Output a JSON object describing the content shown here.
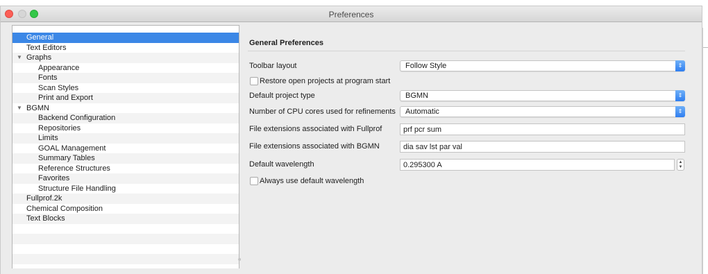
{
  "window": {
    "title": "Preferences"
  },
  "sidebar": {
    "items": [
      {
        "label": "General",
        "level": 0,
        "expandable": false,
        "selected": true
      },
      {
        "label": "Text Editors",
        "level": 0,
        "expandable": false
      },
      {
        "label": "Graphs",
        "level": 0,
        "expandable": true,
        "expanded": true
      },
      {
        "label": "Appearance",
        "level": 1
      },
      {
        "label": "Fonts",
        "level": 1
      },
      {
        "label": "Scan Styles",
        "level": 1
      },
      {
        "label": "Print and Export",
        "level": 1
      },
      {
        "label": "BGMN",
        "level": 0,
        "expandable": true,
        "expanded": true
      },
      {
        "label": "Backend Configuration",
        "level": 1
      },
      {
        "label": "Repositories",
        "level": 1
      },
      {
        "label": "Limits",
        "level": 1
      },
      {
        "label": "GOAL Management",
        "level": 1
      },
      {
        "label": "Summary Tables",
        "level": 1
      },
      {
        "label": "Reference Structures",
        "level": 1
      },
      {
        "label": "Favorites",
        "level": 1
      },
      {
        "label": "Structure File Handling",
        "level": 1
      },
      {
        "label": "Fullprof.2k",
        "level": 0
      },
      {
        "label": "Chemical Composition",
        "level": 0
      },
      {
        "label": "Text Blocks",
        "level": 0
      }
    ],
    "expand_arrow": "▼"
  },
  "main": {
    "title": "General Preferences",
    "toolbar_layout": {
      "label": "Toolbar layout",
      "value": "Follow Style"
    },
    "restore_projects": {
      "label": "Restore open projects at program start",
      "checked": false
    },
    "default_project_type": {
      "label": "Default project type",
      "value": "BGMN"
    },
    "cpu_cores": {
      "label": "Number of CPU cores used for refinements",
      "value": "Automatic"
    },
    "fullprof_ext": {
      "label": "File extensions associated with Fullprof",
      "value": "prf pcr sum"
    },
    "bgmn_ext": {
      "label": "File extensions associated with BGMN",
      "value": "dia sav lst par val"
    },
    "default_wavelength": {
      "label": "Default wavelength",
      "value": "0.295300 A"
    },
    "always_default_wavelength": {
      "label": "Always use default wavelength",
      "checked": false
    }
  },
  "icons": {
    "popup_arrows": "⇕",
    "spin_up": "▲",
    "spin_down": "▼"
  },
  "colors": {
    "selection": "#3b87e6",
    "popup_button": "#2f7ef0",
    "close": "#fc5f57",
    "maximize": "#33c748"
  }
}
